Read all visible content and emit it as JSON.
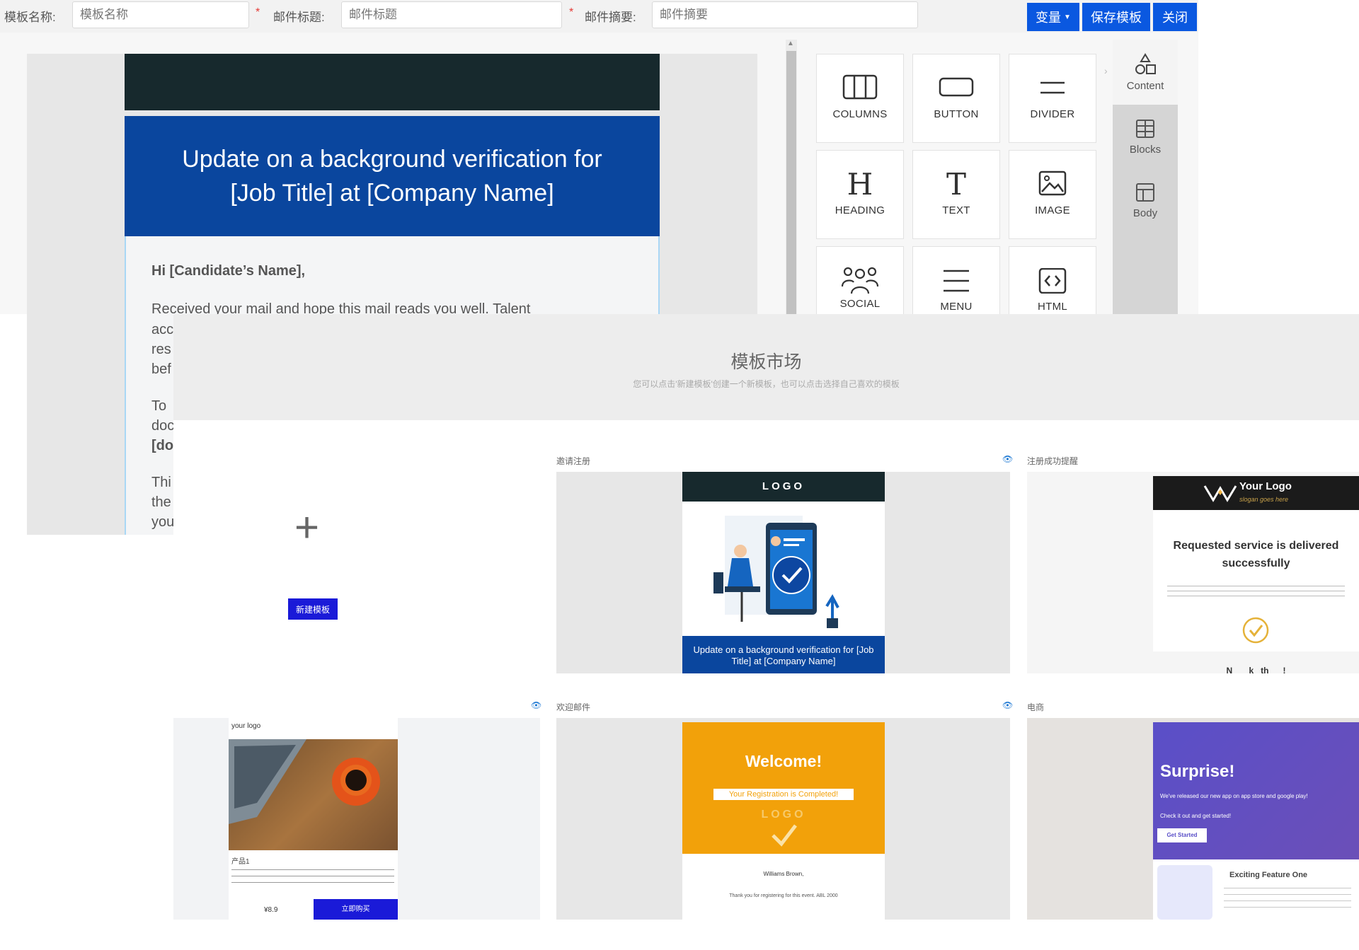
{
  "toolbar": {
    "name_label": "模板名称:",
    "name_placeholder": "模板名称",
    "subject_label": "邮件标题:",
    "subject_placeholder": "邮件标题",
    "summary_label": "邮件摘要:",
    "summary_placeholder": "邮件摘要",
    "required_mark": "*",
    "variables_button": "变量",
    "save_button": "保存模板",
    "close_button": "关闭"
  },
  "editor": {
    "email_title": "Update on a background verification for [Job Title] at [Company Name]",
    "greeting": "Hi [Candidate’s Name],",
    "paragraph_line": "Received your mail and hope this mail reads you well. Talent",
    "cut_lines": [
      "acc",
      "res",
      "bef",
      "To",
      "doc",
      "[do",
      "Thi",
      "the",
      "you"
    ]
  },
  "tools": [
    {
      "label": "COLUMNS",
      "icon": "columns-icon"
    },
    {
      "label": "BUTTON",
      "icon": "button-icon"
    },
    {
      "label": "DIVIDER",
      "icon": "divider-icon"
    },
    {
      "label": "HEADING",
      "icon": "heading-icon"
    },
    {
      "label": "TEXT",
      "icon": "text-icon"
    },
    {
      "label": "IMAGE",
      "icon": "image-icon"
    },
    {
      "label": "SOCIAL",
      "icon": "social-icon"
    },
    {
      "label": "MENU",
      "icon": "menu-icon"
    },
    {
      "label": "HTML",
      "icon": "html-icon"
    }
  ],
  "side_tabs": [
    {
      "label": "Content",
      "icon": "shapes-icon"
    },
    {
      "label": "Blocks",
      "icon": "blocks-icon"
    },
    {
      "label": "Body",
      "icon": "body-layout-icon"
    }
  ],
  "market": {
    "title": "模板市场",
    "subtitle": "您可以点击'新建模板'创建一个新模板，也可以点击选择自己喜欢的模板",
    "new_button": "新建模板",
    "cards": [
      {
        "label": "邀请注册",
        "logo": "LOGO",
        "banner_text": "Update on a background verification for [Job Title] at [Company Name]"
      },
      {
        "label": "注册成功提醒",
        "logo": "Your Logo",
        "tagline": "slogan goes here",
        "heading": "Requested service is delivered successfully",
        "footer_text": "N       k   th      !"
      },
      {
        "label": "",
        "logo": "your logo",
        "product": "产品1",
        "price": "¥8.9",
        "buy_button": "立即购买"
      },
      {
        "label": "欢迎邮件",
        "title": "Welcome!",
        "ribbon": "Your Registration is Completed!",
        "logo": "LOGO",
        "name": "Williams Brown,",
        "note": "Thank you for registering for this event. ABL 2000"
      },
      {
        "label": "电商",
        "title": "Surprise!",
        "line1": "We've released our new app on app store and google play!",
        "line2": "Check it out and get started!",
        "cta": "Get Started",
        "feature": "Exciting Feature One"
      }
    ]
  },
  "colors": {
    "accent": "#0a58e0",
    "email_header": "#17292d",
    "email_banner": "#0a469e",
    "welcome_orange": "#f2a10a",
    "surprise_purple": "#5a4fc8"
  }
}
